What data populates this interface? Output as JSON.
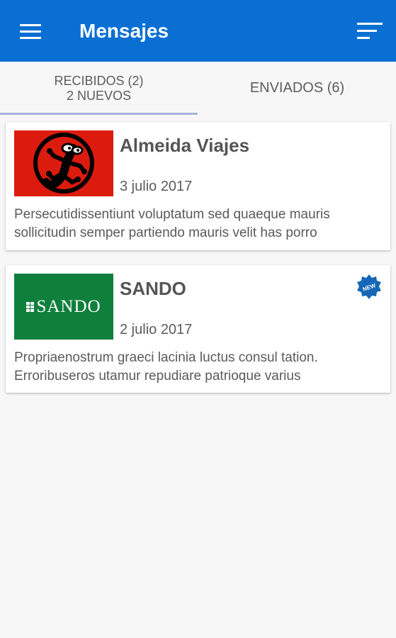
{
  "app_bar": {
    "title": "Mensajes",
    "background_color": "#0a6fd3",
    "menu_icon": "hamburger-menu-icon",
    "sort_icon": "sort-lines-icon"
  },
  "tabs": [
    {
      "line1": "RECIBIDOS (2)",
      "line2": "2 NUEVOS",
      "selected": true
    },
    {
      "line1": "ENVIADOS (6)",
      "line2": "",
      "selected": false
    }
  ],
  "messages": [
    {
      "sender": "Almeida Viajes",
      "date": "3 julio 2017",
      "preview": "Persecutidissentiunt voluptatum sed quaeque mauris sollicitudin semper partiendo mauris velit has porro",
      "logo": "gecko-logo",
      "logo_color": "#dc1b0f",
      "is_new": false
    },
    {
      "sender": "SANDO",
      "date": "2 julio 2017",
      "preview": "Propriaenostrum graeci lacinia luctus consul tation. Erroribuseros utamur repudiare patrioque varius",
      "logo": "sando-logo",
      "logo_text": "SANDO",
      "logo_color": "#0f7f3c",
      "is_new": true,
      "badge_text": "NEW",
      "badge_color": "#1667b7"
    }
  ]
}
